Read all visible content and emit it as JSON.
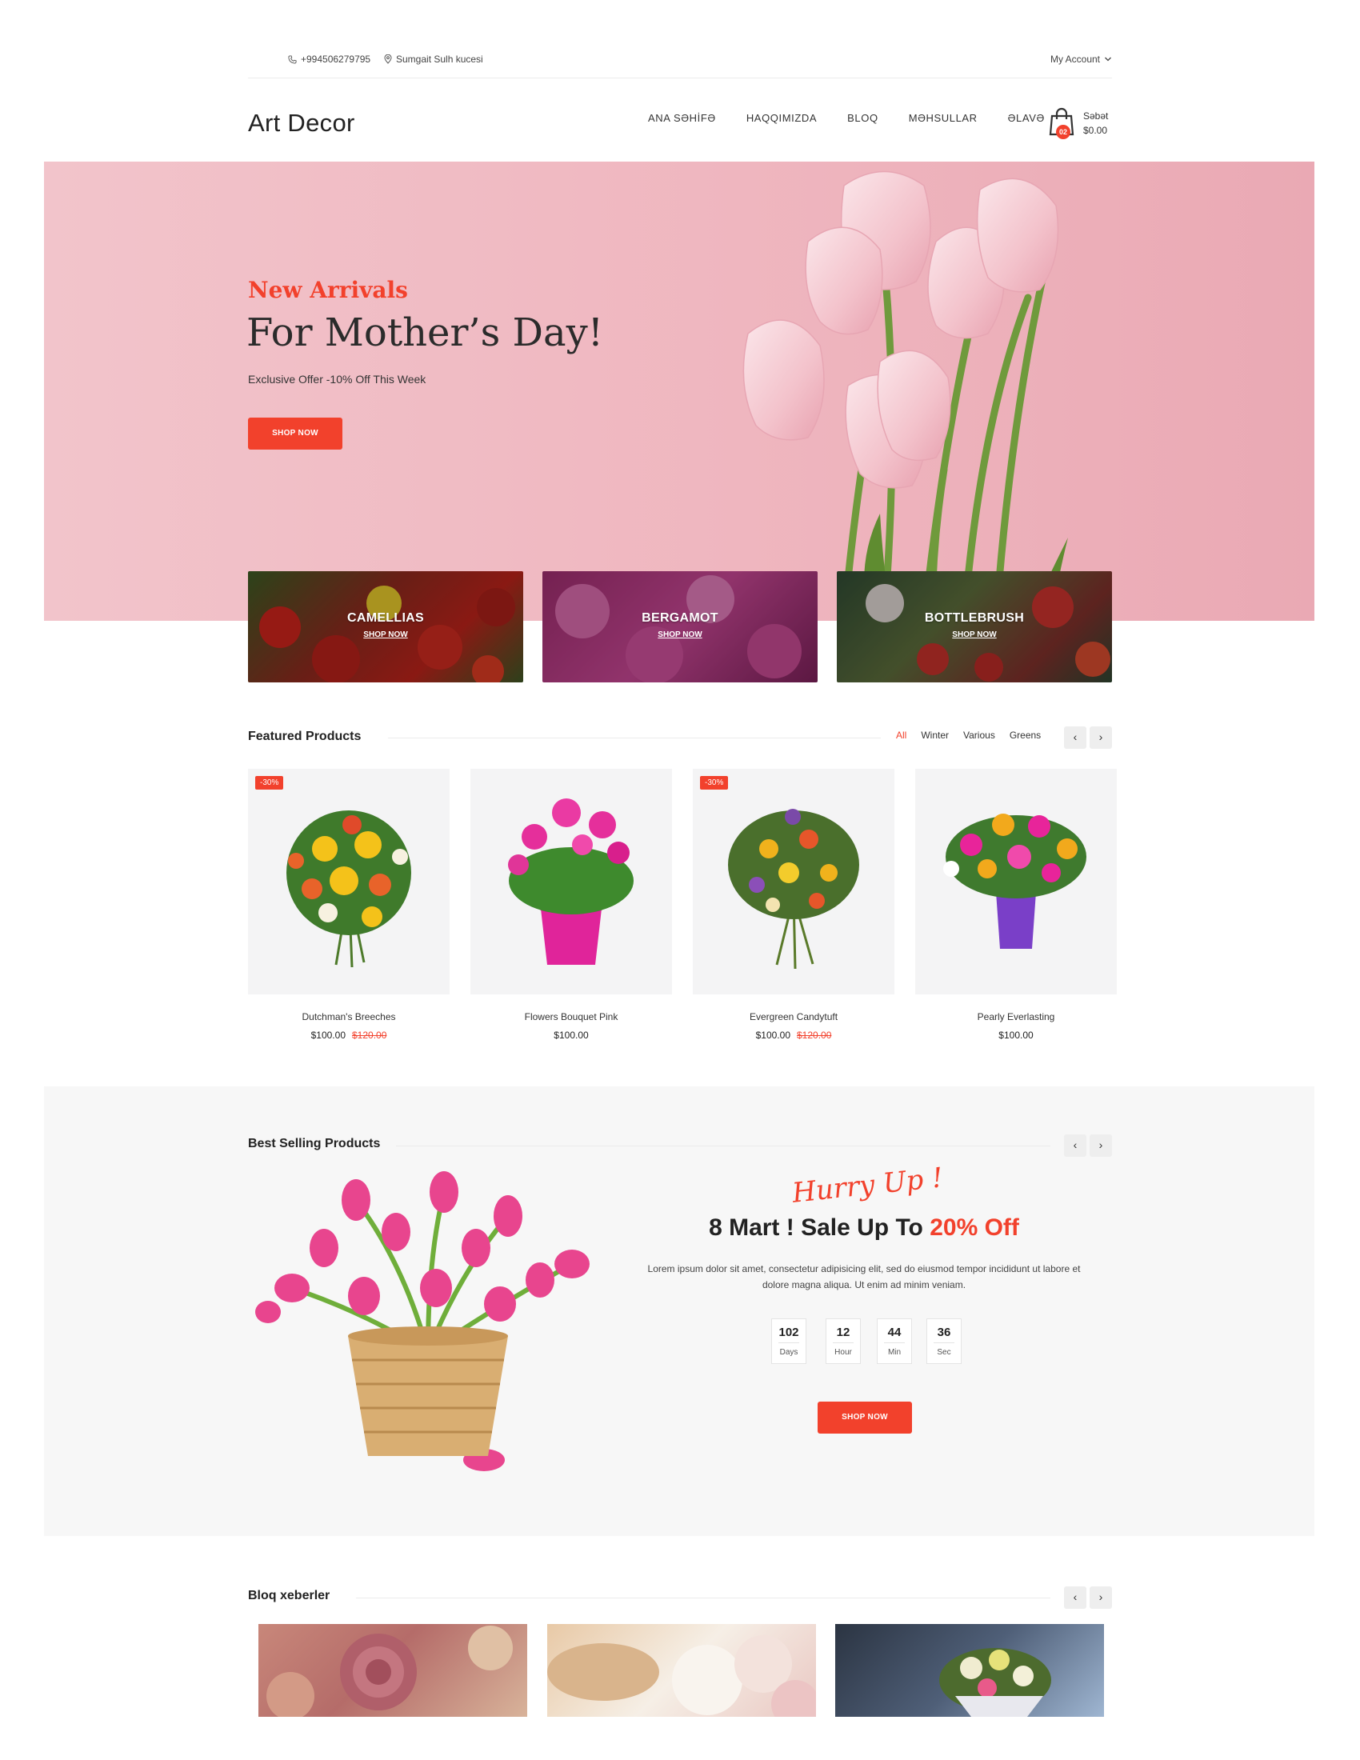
{
  "topbar": {
    "phone": "+994506279795",
    "address": "Sumgait Sulh kucesi",
    "account": "My Account"
  },
  "header": {
    "logo": "Art Decor",
    "nav": [
      "ANA SƏHİFƏ",
      "HAQQIMIZDA",
      "BLOQ",
      "MƏHSULLAR",
      "ƏLAVƏ"
    ],
    "cart_label": "Səbət",
    "cart_total": "$0.00",
    "cart_count": "02"
  },
  "hero": {
    "subtitle": "New Arrivals",
    "title": "For Mother’s Day!",
    "text": "Exclusive Offer -10% Off This Week",
    "button": "SHOP NOW"
  },
  "categories": [
    {
      "title": "CAMELLIAS",
      "link": "SHOP NOW"
    },
    {
      "title": "BERGAMOT",
      "link": "SHOP NOW"
    },
    {
      "title": "BOTTLEBRUSH",
      "link": "SHOP NOW"
    }
  ],
  "featured": {
    "title": "Featured Products",
    "filters": [
      "All",
      "Winter",
      "Various",
      "Greens"
    ],
    "products": [
      {
        "name": "Dutchman's Breeches",
        "price": "$100.00",
        "old_price": "$120.00",
        "badge": "-30%"
      },
      {
        "name": "Flowers Bouquet Pink",
        "price": "$100.00",
        "old_price": "",
        "badge": ""
      },
      {
        "name": "Evergreen Candytuft",
        "price": "$100.00",
        "old_price": "$120.00",
        "badge": "-30%"
      },
      {
        "name": "Pearly Everlasting",
        "price": "$100.00",
        "old_price": "",
        "badge": ""
      }
    ]
  },
  "best": {
    "title": "Best Selling Products",
    "hurry": "Hurry Up !",
    "sale_title": "8 Mart ! Sale Up To ",
    "sale_highlight": "20% Off",
    "text": "Lorem ipsum dolor sit amet, consectetur adipisicing elit, sed do eiusmod tempor incididunt ut labore et dolore magna aliqua. Ut enim ad minim veniam.",
    "countdown": [
      {
        "value": "102",
        "label": "Days"
      },
      {
        "value": "12",
        "label": "Hour"
      },
      {
        "value": "44",
        "label": "Min"
      },
      {
        "value": "36",
        "label": "Sec"
      }
    ],
    "button": "SHOP NOW"
  },
  "blog": {
    "title": "Bloq xeberler"
  },
  "arrows": {
    "prev": "‹",
    "next": "›"
  },
  "colors": {
    "accent": "#f2412c",
    "hero_bg": "#efb6bf",
    "section_bg": "#f7f7f7"
  }
}
